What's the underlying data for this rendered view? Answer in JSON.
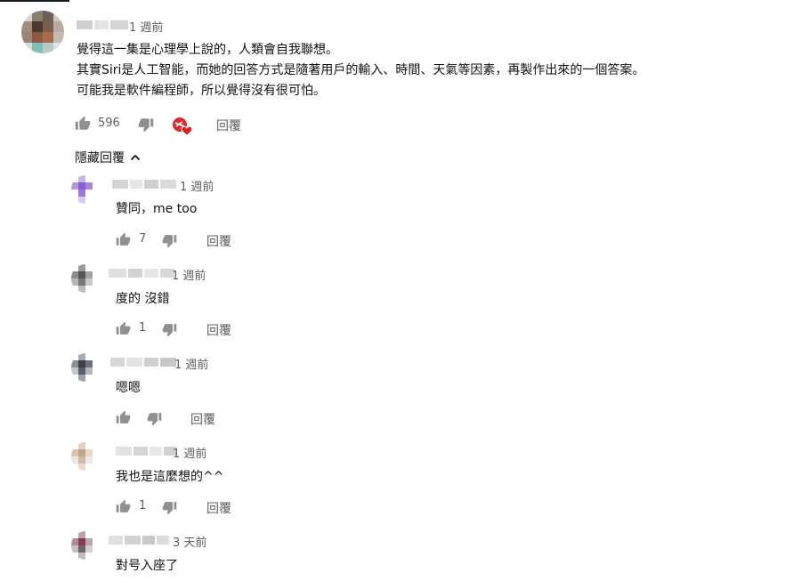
{
  "main_comment": {
    "time": "1 週前",
    "text_lines": [
      "覺得這一集是心理學上說的，人類會自我聯想。",
      "其實Siri是人工智能，而她的回答方式是隨著用戶的輸入、時間、天氣等因素，再製作出來的一個答案。",
      "可能我是軟件編程師，所以覺得沒有很可怕。"
    ],
    "like_count": "596",
    "reply_label": "回覆"
  },
  "hide_replies_label": "隱藏回覆",
  "replies": [
    {
      "time": "1 週前",
      "text": "贊同，me too",
      "like_count": "7",
      "reply_label": "回覆"
    },
    {
      "time": "1 週前",
      "text": "度的 沒錯",
      "like_count": "1",
      "reply_label": "回覆"
    },
    {
      "time": "1 週前",
      "text": "嗯嗯",
      "like_count": "",
      "reply_label": "回覆"
    },
    {
      "time": "1 週前",
      "text": "我也是這麼想的^^",
      "like_count": "1",
      "reply_label": "回覆"
    },
    {
      "time": "3 天前",
      "text": "對号入座了",
      "like_count": "",
      "reply_label": ""
    }
  ],
  "colors": {
    "icon": "#909090",
    "secondary_text": "#606060",
    "heart": "#e02020",
    "creator_badge": "#d32f2f"
  },
  "icons": [
    "thumb-up-icon",
    "thumb-down-icon",
    "creator-heart-icon",
    "chevron-up-icon"
  ]
}
